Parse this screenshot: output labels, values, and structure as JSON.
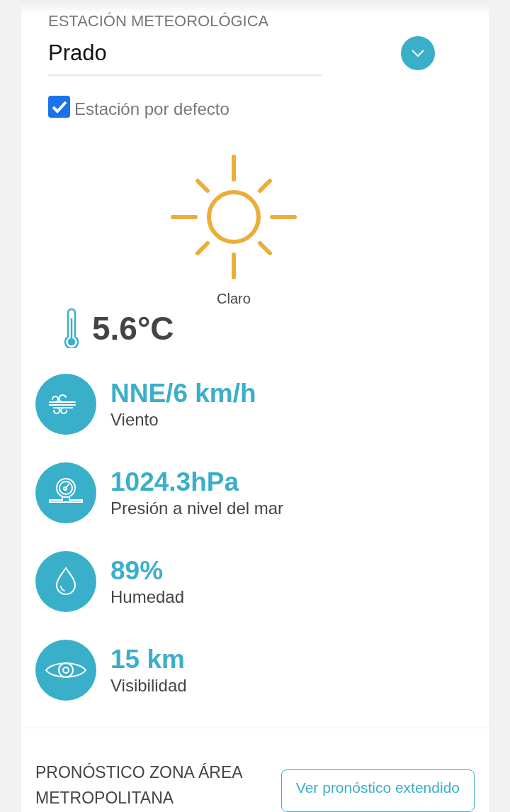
{
  "station": {
    "label": "ESTACIÓN METEOROLÓGICA",
    "value": "Prado"
  },
  "default_station": {
    "label": "Estación por defecto",
    "checked": true
  },
  "condition": {
    "kind": "sunny",
    "label": "Claro"
  },
  "temperature": "5.6°C",
  "metrics": [
    {
      "kind": "wind",
      "value": "NNE/6 km/h",
      "label": "Viento"
    },
    {
      "kind": "pressure",
      "value": "1024.3hPa",
      "label": "Presión a nivel del mar"
    },
    {
      "kind": "humidity",
      "value": "89%",
      "label": "Humedad"
    },
    {
      "kind": "visibility",
      "value": "15 km",
      "label": "Visibilidad"
    }
  ],
  "forecast": {
    "title": "PRONÓSTICO ZONA ÁREA METROPOLITANA",
    "button": "Ver pronóstico extendido"
  }
}
